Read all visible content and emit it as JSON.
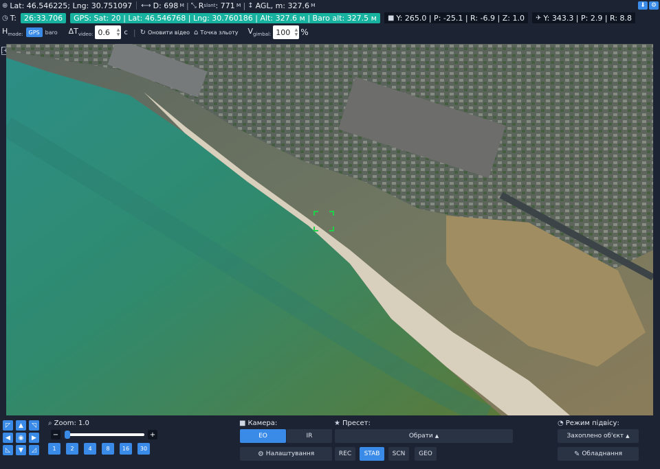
{
  "header": {
    "drone_coords": "Lat: 46.546225; Lng: 30.751097",
    "distance_label": "D: 698",
    "distance_unit": "м",
    "r_slant_label": "R",
    "r_slant_sub": "slant",
    "r_slant_value": ": 771",
    "r_slant_unit": "м",
    "agl_label": "AGL, m: 327.6",
    "agl_unit": "м",
    "time_label": "T:",
    "time_value": "26:33.706",
    "gps_status": "GPS: Sat: 20 | Lat: 46.546768 | Lng: 30.760186 | Alt: 327.6 м | Baro alt: 327.5 м",
    "camera_attitude": "Y: 265.0 | P: -25.1 | R: -6.9 | Z: 1.0",
    "aircraft_attitude": "Y: 343.3 | P: 2.9 | R: 8.8"
  },
  "controls": {
    "h_mode_label": "H",
    "h_mode_sub": "mode:",
    "h_mode_options": [
      "GPS",
      "baro"
    ],
    "dt_video_label": "ΔT",
    "dt_video_sub": "video:",
    "dt_video_value": "0.6",
    "dt_video_unit": "с",
    "refresh_video": "Оновити відео",
    "takeoff_point": "Точка зльоту",
    "v_gimbal_label": "V",
    "v_gimbal_sub": "gimbal:",
    "v_gimbal_value": "100",
    "v_gimbal_unit": "%"
  },
  "map": {
    "expand_icon": "[+]"
  },
  "zoom": {
    "label": "Zoom: 1.0",
    "value": 1.0,
    "min": 1,
    "max": 30,
    "presets": [
      "1",
      "2",
      "4",
      "8",
      "16",
      "30"
    ]
  },
  "camera": {
    "label": "Камера:",
    "modes": [
      "EO",
      "IR"
    ],
    "settings_button": "Налаштування"
  },
  "preset": {
    "label": "Пресет:",
    "select_value": "Обрати",
    "buttons": [
      "REC",
      "STAB",
      "SCN",
      "GEO"
    ]
  },
  "tracking": {
    "label": "Режим підвісу:",
    "mode_value": "Захоплено об'єкт",
    "equipment_button": "Обладнання"
  },
  "colors": {
    "accent": "#3a8ae8",
    "teal": "#17b3a0",
    "panel_bg": "#1c2333",
    "button_bg": "#2a3344",
    "target_marker": "#1fd24a"
  }
}
